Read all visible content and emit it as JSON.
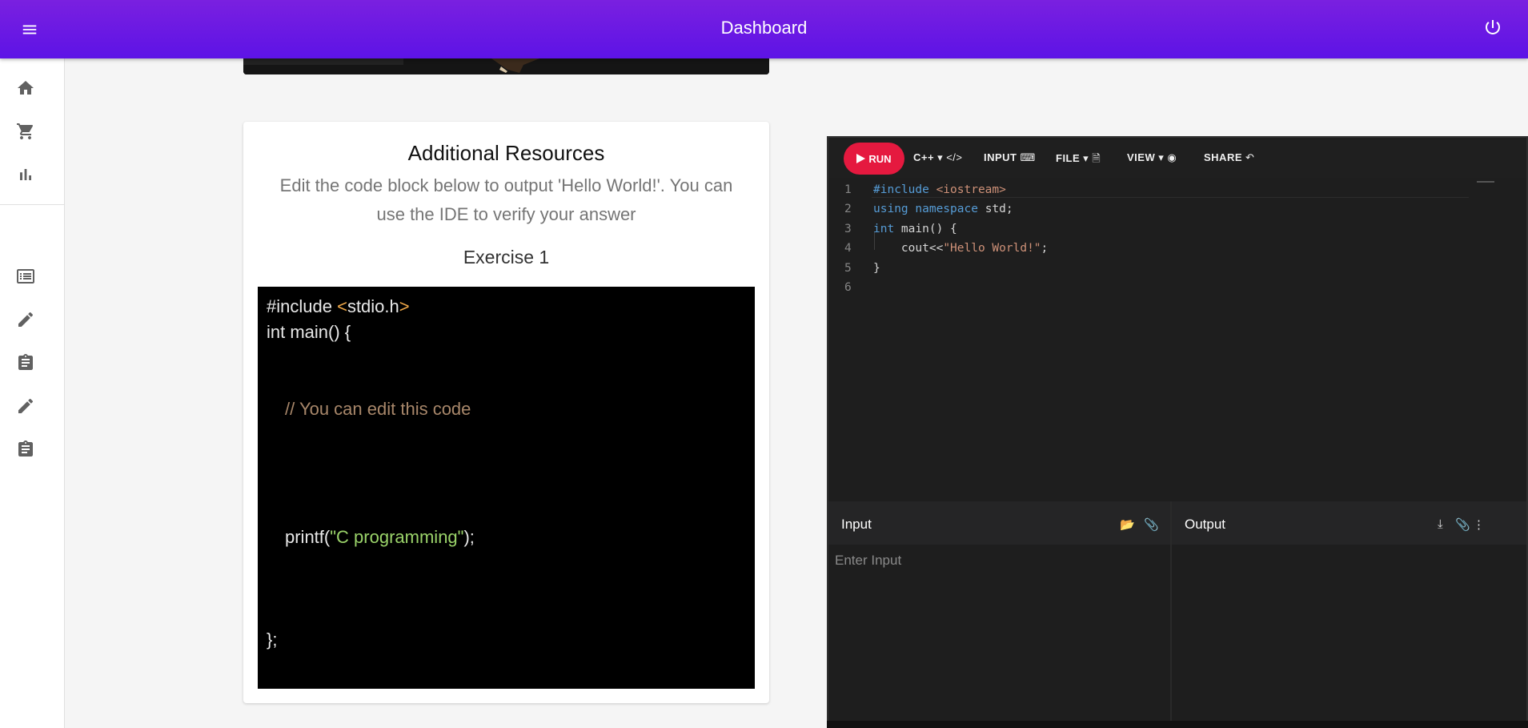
{
  "appbar": {
    "title": "Dashboard",
    "menu_icon": "menu-icon",
    "power_icon": "power-icon",
    "colors": {
      "gradient_top": "#7a20e0",
      "gradient_bottom": "#5d13e6"
    }
  },
  "sidebar": {
    "top_items": [
      {
        "icon": "home-icon"
      },
      {
        "icon": "cart-icon"
      },
      {
        "icon": "bar-chart-icon"
      }
    ],
    "bottom_items": [
      {
        "icon": "list-icon"
      },
      {
        "icon": "pencil-icon"
      },
      {
        "icon": "clipboard-icon"
      },
      {
        "icon": "pencil-icon"
      },
      {
        "icon": "clipboard-icon"
      }
    ]
  },
  "card": {
    "heading": "Additional Resources",
    "description": "Edit the code block below to output 'Hello World!'. You can use the IDE to verify your answer",
    "exercise_title": "Exercise 1",
    "code": {
      "line1_a": "#include ",
      "line1_b": "<",
      "line1_c": "stdio.h",
      "line1_d": ">",
      "line2": "int main() {",
      "comment": "// You can edit this code",
      "printf_a": "printf(",
      "printf_b": "\"C programming\"",
      "printf_c": ");",
      "closing": "};"
    }
  },
  "ide": {
    "toolbar": {
      "run": "RUN",
      "language": "C++",
      "input": "INPUT",
      "file": "FILE",
      "view": "VIEW",
      "share": "SHARE"
    },
    "editor": {
      "line_numbers": [
        "1",
        "2",
        "3",
        "4",
        "5",
        "6"
      ],
      "l1_a": "#include",
      "l1_b": " <iostream>",
      "l2_a": "using",
      "l2_b": " ",
      "l2_c": "namespace",
      "l2_d": " std;",
      "l3_a": "int",
      "l3_b": " main() {",
      "l4_a": "    cout<<",
      "l4_b": "\"Hello World!\"",
      "l4_c": ";",
      "l5": "}",
      "l6": ""
    },
    "input_label": "Input",
    "input_placeholder": "Enter Input",
    "output_label": "Output",
    "colors": {
      "run": "#e5193f",
      "editor_bg": "#1e1e1e"
    }
  }
}
